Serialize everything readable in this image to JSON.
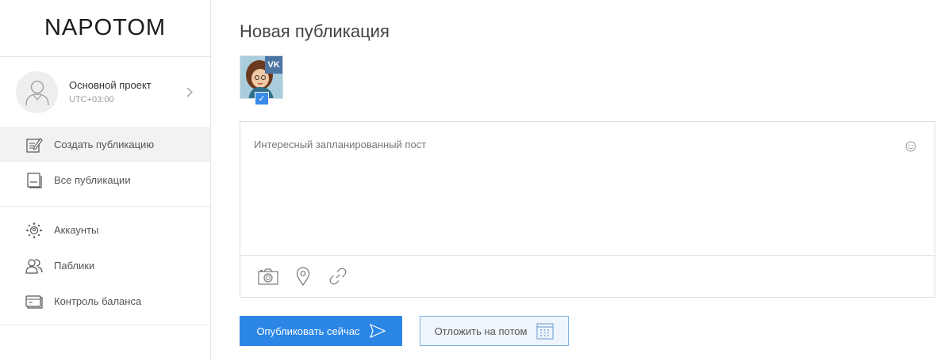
{
  "sidebar": {
    "logo": "NAPOTOM",
    "project": {
      "name": "Основной проект",
      "timezone": "UTC+03:00"
    },
    "nav": [
      {
        "label": "Создать публикацию",
        "icon": "edit-document-icon",
        "active": true
      },
      {
        "label": "Все публикации",
        "icon": "documents-icon",
        "active": false
      }
    ],
    "nav2": [
      {
        "label": "Аккаунты",
        "icon": "accounts-icon"
      },
      {
        "label": "Паблики",
        "icon": "users-icon"
      },
      {
        "label": "Контроль баланса",
        "icon": "wallet-icon"
      }
    ]
  },
  "main": {
    "title": "Новая публикация",
    "account": {
      "network": "VK",
      "selected": true
    },
    "editor": {
      "text": "Интересный запланированный пост"
    },
    "buttons": {
      "publish_now": "Опубликовать сейчас",
      "schedule": "Отложить на потом"
    }
  },
  "colors": {
    "primary": "#2b86e5",
    "vk": "#4c75a3"
  }
}
